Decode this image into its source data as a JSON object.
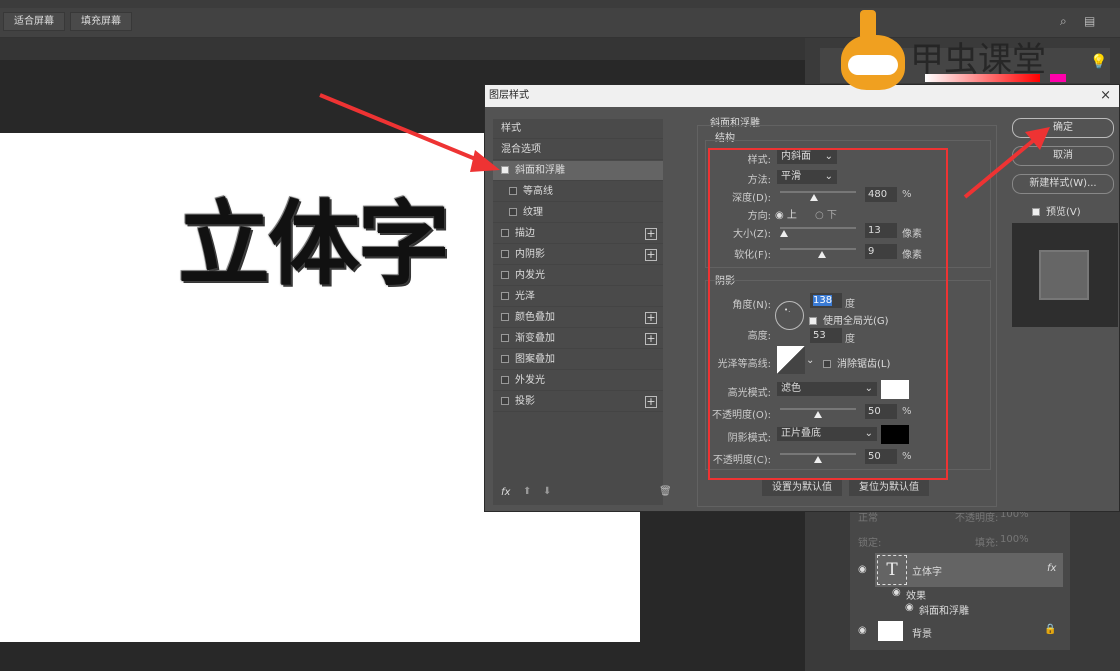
{
  "options_bar": {
    "fit_screen": "适合屏幕",
    "fill_screen": "填充屏幕"
  },
  "canvas": {
    "text": "立体字"
  },
  "dialog": {
    "title": "图层样式",
    "left_list": {
      "header": "样式",
      "blend": "混合选项",
      "items": [
        {
          "label": "斜面和浮雕",
          "checked": true,
          "selected": true,
          "plus": false
        },
        {
          "label": "等高线",
          "checked": false,
          "sub": true,
          "plus": false
        },
        {
          "label": "纹理",
          "checked": false,
          "sub": true,
          "plus": false
        },
        {
          "label": "描边",
          "checked": false,
          "plus": true
        },
        {
          "label": "内阴影",
          "checked": false,
          "plus": true
        },
        {
          "label": "内发光",
          "checked": false,
          "plus": false
        },
        {
          "label": "光泽",
          "checked": false,
          "plus": false
        },
        {
          "label": "颜色叠加",
          "checked": false,
          "plus": true
        },
        {
          "label": "渐变叠加",
          "checked": false,
          "plus": true
        },
        {
          "label": "图案叠加",
          "checked": false,
          "plus": false
        },
        {
          "label": "外发光",
          "checked": false,
          "plus": false
        },
        {
          "label": "投影",
          "checked": false,
          "plus": true
        }
      ],
      "fx": "fx"
    },
    "section_title": "斜面和浮雕",
    "structure": {
      "title": "结构",
      "style_label": "样式:",
      "style": "内斜面",
      "technique_label": "方法:",
      "technique": "平滑",
      "depth_label": "深度(D):",
      "depth": "480",
      "depth_unit": "%",
      "depth_slider": 0.45,
      "direction_label": "方向:",
      "up": "上",
      "down": "下",
      "direction": "上",
      "size_label": "大小(Z):",
      "size": "13",
      "size_unit": "像素",
      "size_slider": 0.05,
      "soften_label": "软化(F):",
      "soften": "9",
      "soften_unit": "像素",
      "soften_slider": 0.55
    },
    "shading": {
      "title": "阴影",
      "angle_label": "角度(N):",
      "angle": "138",
      "angle_unit": "度",
      "global_light": "使用全局光(G)",
      "global_light_checked": true,
      "altitude_label": "高度:",
      "altitude": "53",
      "altitude_unit": "度",
      "gloss_label": "光泽等高线:",
      "anti_alias": "消除锯齿(L)",
      "anti_alias_checked": false,
      "highlight_label": "高光模式:",
      "highlight_mode": "滤色",
      "highlight_color": "#ffffff",
      "highlight_opacity_label": "不透明度(O):",
      "highlight_opacity": "50",
      "pct": "%",
      "highlight_slider": 0.5,
      "shadow_label": "阴影模式:",
      "shadow_mode": "正片叠底",
      "shadow_color": "#000000",
      "shadow_opacity_label": "不透明度(C):",
      "shadow_opacity": "50",
      "shadow_slider": 0.5
    },
    "make_default": "设置为默认值",
    "reset_default": "复位为默认值",
    "ok": "确定",
    "cancel": "取消",
    "new_style": "新建样式(W)...",
    "preview": "预览(V)",
    "preview_checked": true
  },
  "layers": {
    "blend": "正常",
    "opacity_label": "不透明度:",
    "opacity": "100%",
    "lock_label": "锁定:",
    "fill_label": "填充:",
    "fill": "100%",
    "items": [
      {
        "name": "立体字",
        "type": "text",
        "fx": "fx"
      },
      {
        "name": "效果"
      },
      {
        "name": "斜面和浮雕"
      },
      {
        "name": "背景",
        "locked": true
      }
    ]
  },
  "watermark": {
    "text": "甲虫课堂",
    "color": "#f0a020"
  },
  "accent": "#e33333"
}
